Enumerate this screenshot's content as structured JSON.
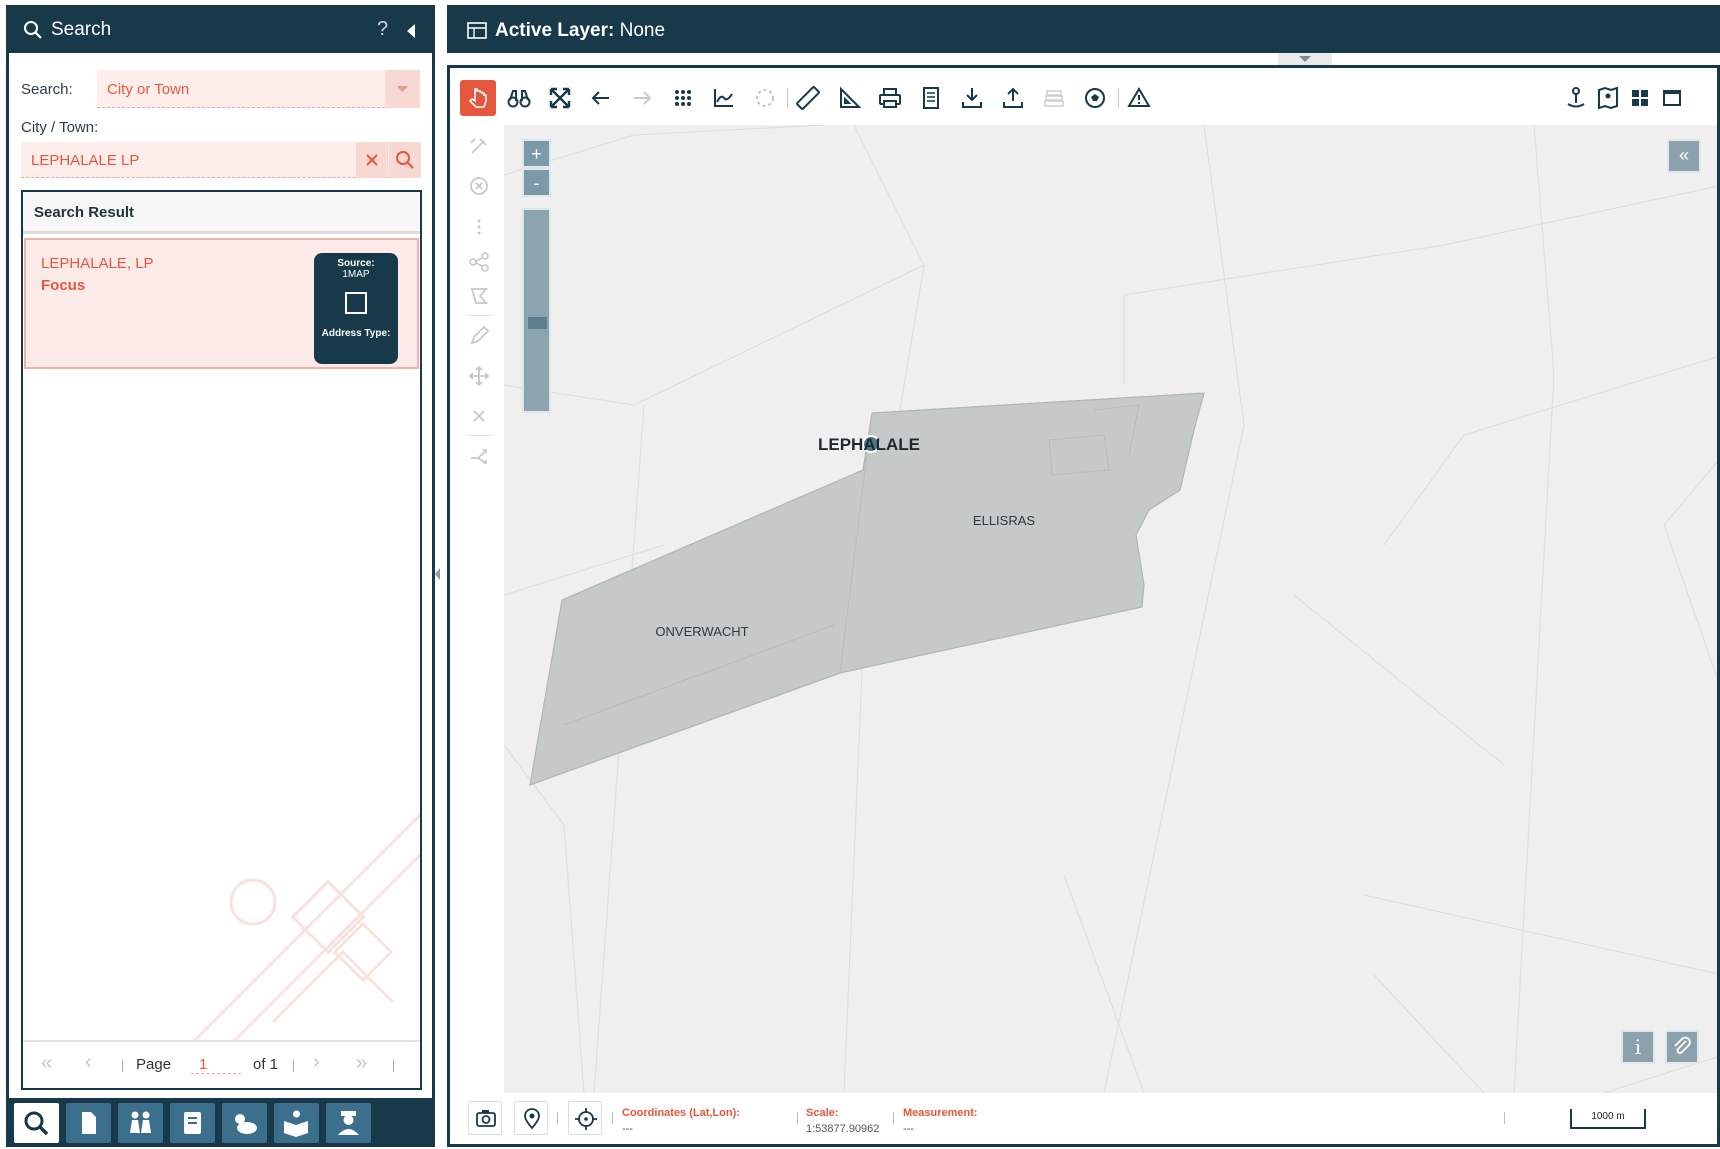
{
  "search_panel": {
    "title": "Search",
    "help": "?",
    "search_label": "Search:",
    "search_type": "City or Town",
    "city_label": "City / Town:",
    "city_value": "LEPHALALE LP",
    "results_title": "Search Result",
    "result": {
      "name": "LEPHALALE, LP",
      "focus_label": "Focus",
      "source_label": "Source:",
      "source_value": "1MAP",
      "address_type_label": "Address Type:"
    },
    "pager": {
      "page_label": "Page",
      "page_value": "1",
      "of_label": "of 1"
    }
  },
  "map_header": {
    "title_bold": "Active Layer:",
    "title_value": "None"
  },
  "map": {
    "labels": {
      "main_town": "LEPHALALE",
      "area1": "ELLISRAS",
      "area2": "ONVERWACHT"
    },
    "zoom_in": "+",
    "zoom_out": "-",
    "collapse": "«",
    "info": "i"
  },
  "status": {
    "coords_label": "Coordinates (Lat,Lon):",
    "coords_value": "---",
    "scale_label": "Scale:",
    "scale_value": "1:53877.90962",
    "measure_label": "Measurement:",
    "measure_value": "---",
    "scalebar": "1000 m"
  },
  "colors": {
    "navy": "#17394a",
    "accent": "#e4573d",
    "polygon": "#c5c9c7"
  }
}
